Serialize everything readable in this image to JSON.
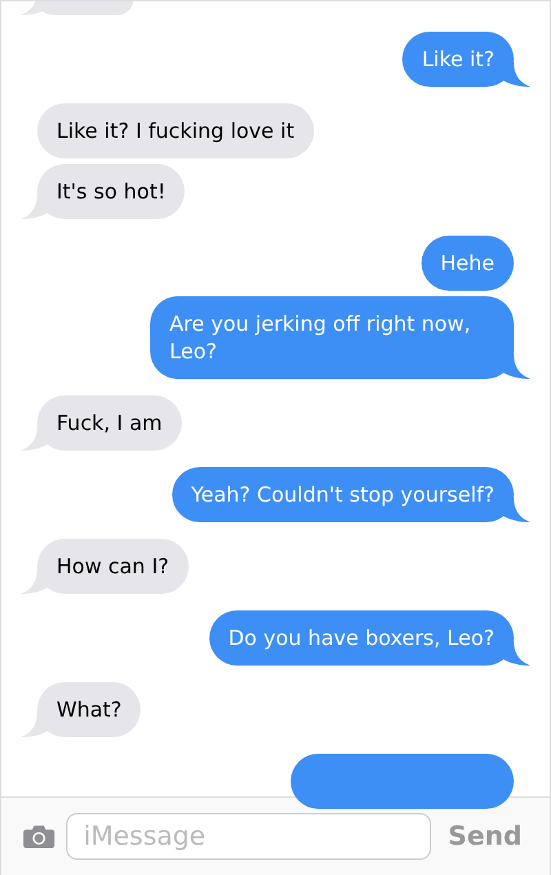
{
  "messages": [
    {
      "kind": "received",
      "tail": true
    },
    {
      "kind": "sent",
      "text": "Like it?",
      "tail": true
    },
    {
      "kind": "received",
      "text": "Like it? I fucking love it",
      "tail": false
    },
    {
      "kind": "received",
      "text": "It's so hot!",
      "tail": true
    },
    {
      "kind": "sent",
      "text": "Hehe",
      "tail": false
    },
    {
      "kind": "sent",
      "text": "Are you jerking off right now, Leo?",
      "tail": true
    },
    {
      "kind": "received",
      "text": "Fuck, I am",
      "tail": true
    },
    {
      "kind": "sent",
      "text": "Yeah? Couldn't stop yourself?",
      "tail": true
    },
    {
      "kind": "received",
      "text": "How can I?",
      "tail": true
    },
    {
      "kind": "sent",
      "text": "Do you have boxers, Leo?",
      "tail": true
    },
    {
      "kind": "received",
      "text": "What?",
      "tail": true
    },
    {
      "kind": "sent",
      "tail": false
    }
  ],
  "composer": {
    "placeholder": "iMessage",
    "send": "Send"
  }
}
